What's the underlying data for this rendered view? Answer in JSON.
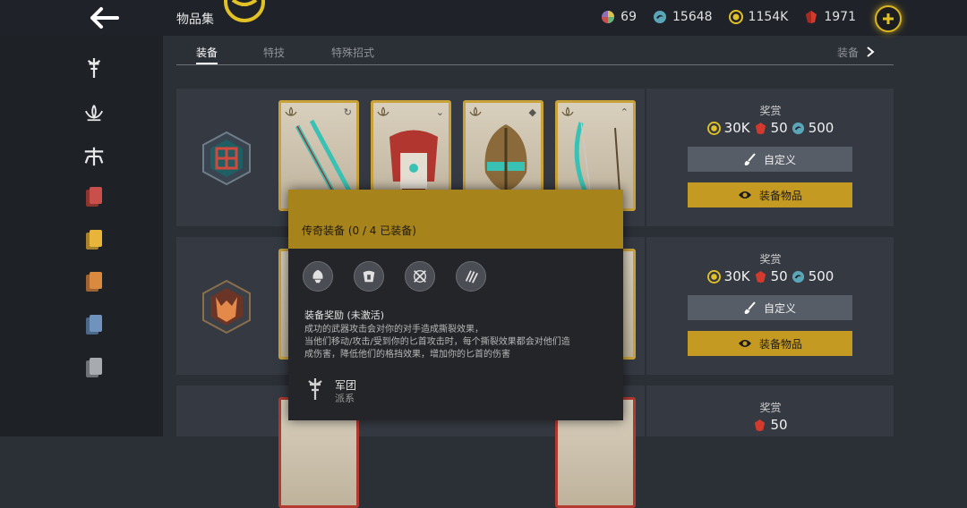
{
  "header": {
    "title": "物品集",
    "currencies": [
      {
        "icon": "multicolor-gem-icon",
        "value": "69"
      },
      {
        "icon": "steel-icon",
        "value": "15648"
      },
      {
        "icon": "gold-coin-icon",
        "value": "1154K"
      },
      {
        "icon": "ruby-icon",
        "value": "1971"
      }
    ]
  },
  "tabs": [
    {
      "label": "装备",
      "active": true
    },
    {
      "label": "特技",
      "active": false
    },
    {
      "label": "特殊招式",
      "active": false
    }
  ],
  "tab_next": "装备",
  "rows": [
    {
      "reward_title": "奖赏",
      "coins": "30K",
      "rubies": "50",
      "steel": "500",
      "customize_label": "自定义",
      "equip_label": "装备物品"
    },
    {
      "reward_title": "奖赏",
      "coins": "30K",
      "rubies": "50",
      "steel": "500",
      "customize_label": "自定义",
      "equip_label": "装备物品"
    },
    {
      "reward_title": "奖赏",
      "rubies": "50"
    }
  ],
  "tooltip": {
    "title": "传奇装备 (0 / 4 已装备)",
    "bonus_title": "装备奖励 (未激活)",
    "description_lines": [
      "成功的武器攻击会对你的对手造成撕裂效果，",
      "当他们移动/攻击/受到你的匕首攻击时，每个撕裂效果都会对他们造",
      "成伤害，降低他们的格挡效果，增加你的匕首的伤害"
    ],
    "faction_name": "军团",
    "faction_type": "派系"
  },
  "colors": {
    "gold": "#c59a22",
    "tooltip_header": "#a7831c",
    "panel": "#353a42",
    "background": "#2b2f36",
    "sidebar_red": "#c9504a",
    "sidebar_yellow": "#e8b43a",
    "sidebar_orange": "#d98a3e",
    "sidebar_blue": "#6f93bd",
    "sidebar_gray": "#a7aaae"
  }
}
